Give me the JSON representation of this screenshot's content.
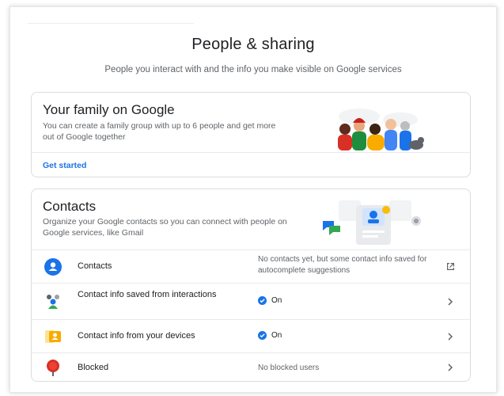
{
  "header": {
    "title": "People & sharing",
    "subtitle": "People you interact with and the info you make visible on Google services"
  },
  "family": {
    "title": "Your family on Google",
    "description": "You can create a family group with up to 6 people and get more out of Google together",
    "action": "Get started"
  },
  "contacts_section": {
    "title": "Contacts",
    "description": "Organize your Google contacts so you can connect with people on Google services, like Gmail",
    "rows": [
      {
        "label": "Contacts",
        "value": "No contacts yet, but some contact info saved for autocomplete suggestions",
        "icon": "person-circle-icon",
        "trailing_icon": "open-in-new-icon"
      },
      {
        "label": "Contact info saved from interactions",
        "value": "On",
        "icon": "people-interactions-icon",
        "trailing_icon": "chevron-right-icon"
      },
      {
        "label": "Contact info from your devices",
        "value": "On",
        "icon": "device-contacts-icon",
        "trailing_icon": "chevron-right-icon"
      },
      {
        "label": "Blocked",
        "value": "No blocked users",
        "icon": "blocked-pin-icon",
        "trailing_icon": "chevron-right-icon"
      }
    ]
  },
  "colors": {
    "accent": "#1a73e8",
    "text_primary": "#202124",
    "text_secondary": "#5f6368",
    "border": "#dadce0",
    "blocked_red": "#d93025"
  }
}
